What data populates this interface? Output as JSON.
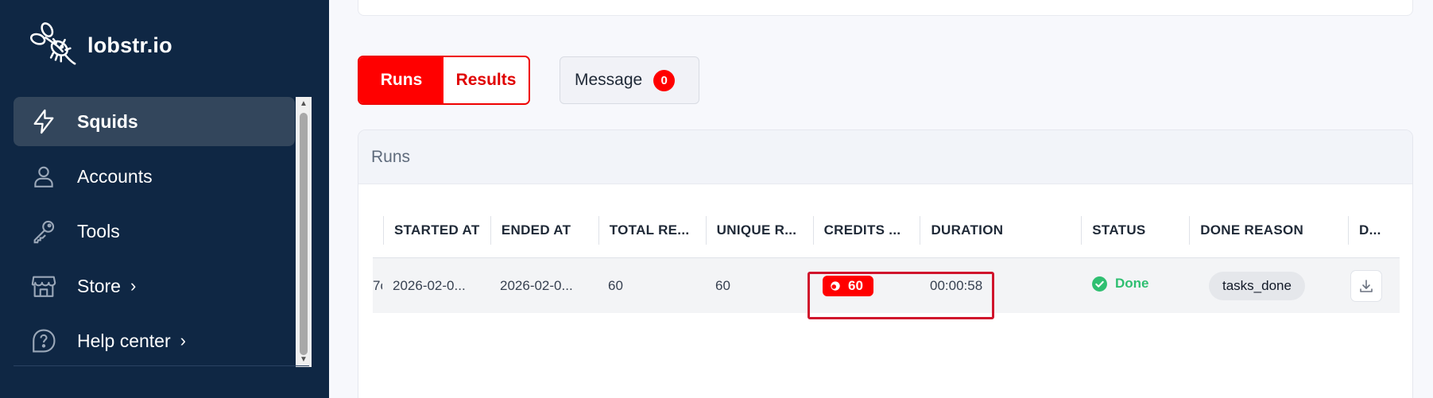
{
  "app": {
    "name": "lobstr.io",
    "logo_icon": "lobster-logo-icon"
  },
  "sidebar": {
    "items": [
      {
        "label": "Squids",
        "icon": "lightning-icon",
        "active": true,
        "chevron": ""
      },
      {
        "label": "Accounts",
        "icon": "user-icon",
        "active": false,
        "chevron": ""
      },
      {
        "label": "Tools",
        "icon": "key-icon",
        "active": false,
        "chevron": ""
      },
      {
        "label": "Store",
        "icon": "store-icon",
        "active": false,
        "chevron": "›"
      },
      {
        "label": "Help center",
        "icon": "help-icon",
        "active": false,
        "chevron": "›"
      }
    ],
    "scroll_up": "▲",
    "scroll_down": "▼"
  },
  "tabs": {
    "runs": "Runs",
    "results": "Results"
  },
  "message": {
    "label": "Message",
    "count": "0"
  },
  "runs_card": {
    "title": "Runs"
  },
  "table": {
    "columns": [
      "STARTED AT",
      "ENDED AT",
      "TOTAL RE...",
      "UNIQUE R...",
      "CREDITS ...",
      "DURATION",
      "STATUS",
      "DONE REASON",
      "D..."
    ],
    "rows": [
      {
        "cut": "7c",
        "started_at": "2026-02-0...",
        "ended_at": "2026-02-0...",
        "total_results": "60",
        "unique_results": "60",
        "credits": "60",
        "duration": "00:00:58",
        "status": "Done",
        "done_reason": "tasks_done"
      }
    ]
  },
  "colors": {
    "sidebar_bg": "#0f2744",
    "accent_red": "#ff0000",
    "status_green": "#2fbf71",
    "highlight": "#d0142c"
  }
}
